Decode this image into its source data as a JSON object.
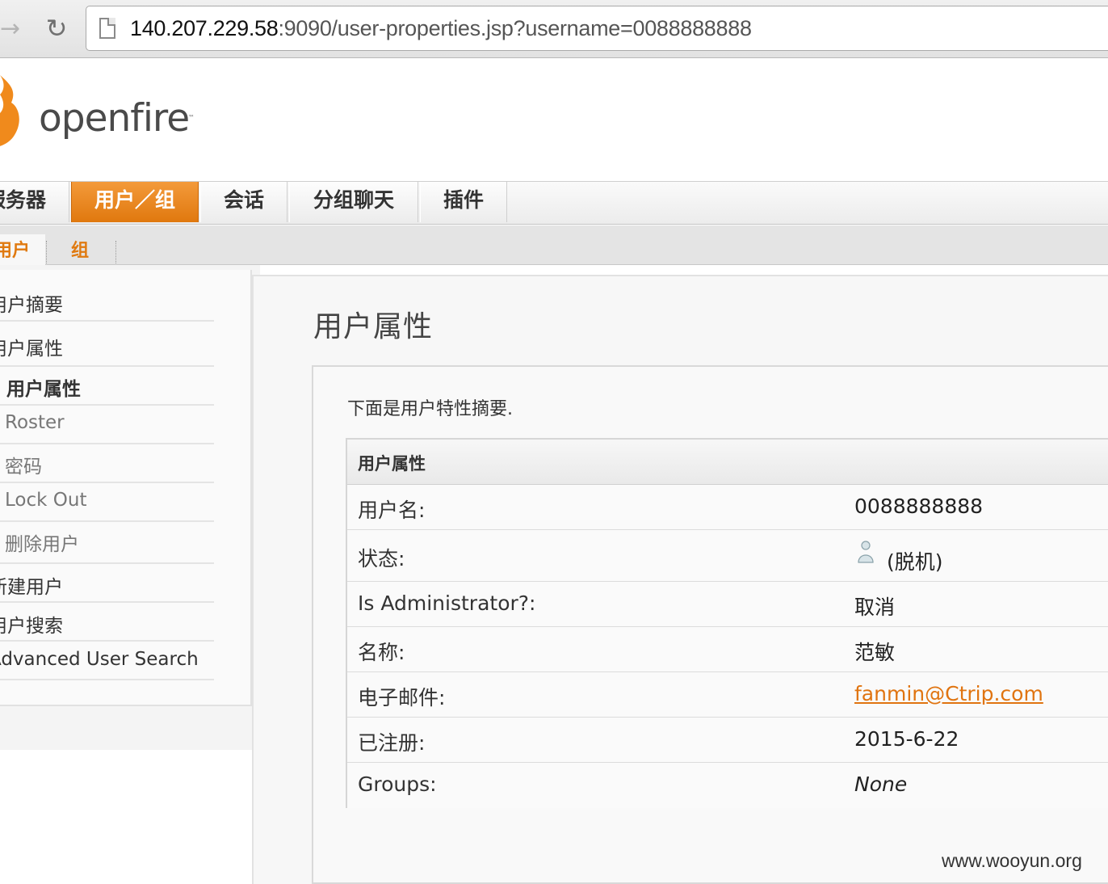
{
  "browser": {
    "url_host": "140.207.229.58",
    "url_rest": ":9090/user-properties.jsp?username=0088888888",
    "forward_icon": "arrow-right-icon",
    "reload_icon": "reload-icon"
  },
  "logo": {
    "text": "openfire",
    "tm": "™"
  },
  "tabs": [
    {
      "label": "服务器"
    },
    {
      "label": "用户／组"
    },
    {
      "label": "会话"
    },
    {
      "label": "分组聊天"
    },
    {
      "label": "插件"
    }
  ],
  "subtabs": [
    {
      "label": "用户"
    },
    {
      "label": "组"
    }
  ],
  "sidebar": {
    "items": [
      {
        "label": "用户摘要"
      },
      {
        "label": "用户属性"
      },
      {
        "label": "用户属性"
      },
      {
        "label": "Roster"
      },
      {
        "label": "密码"
      },
      {
        "label": "Lock Out"
      },
      {
        "label": "删除用户"
      },
      {
        "label": "新建用户"
      },
      {
        "label": "用户搜索"
      },
      {
        "label": "Advanced User Search"
      }
    ]
  },
  "main": {
    "title": "用户属性",
    "intro": "下面是用户特性摘要.",
    "table": {
      "header": "用户属性",
      "rows": [
        {
          "label": "用户名:",
          "value": "0088888888"
        },
        {
          "label": "状态:",
          "value": "(脱机)"
        },
        {
          "label": "Is Administrator?:",
          "value": "取消"
        },
        {
          "label": "名称:",
          "value": "范敏"
        },
        {
          "label": "电子邮件:",
          "value": "fanmin@Ctrip.com"
        },
        {
          "label": "已注册:",
          "value": "2015-6-22"
        },
        {
          "label": "Groups:",
          "value": "None"
        }
      ]
    }
  },
  "watermark": "www.wooyun.org",
  "colors": {
    "accent": "#e07a10",
    "link": "#e07410"
  }
}
